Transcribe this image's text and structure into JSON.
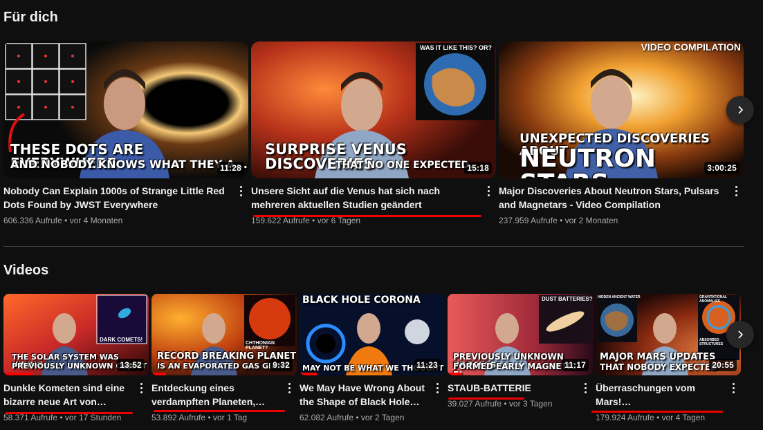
{
  "sections": {
    "for_you": {
      "title": "Für dich",
      "cards": [
        {
          "title": "Nobody Can Explain 1000s of Strange Little Red Dots Found by JWST Everywhere",
          "stats": "606.336 Aufrufe • vor 4 Monaten",
          "duration": "11:28",
          "overlay_line1": "THESE DOTS ARE EVERYWHERE",
          "overlay_line2": "AND NOBODY KNOWS WHAT THEY A..."
        },
        {
          "title": "Unsere Sicht auf die Venus hat sich nach mehreren aktuellen Studien geändert",
          "stats": "159.622 Aufrufe • vor 6 Tagen",
          "duration": "15:18",
          "overlay_line1": "SURPRISE VENUS DISCOVERIES",
          "overlay_line2": "THAT NO ONE EXPECTED...",
          "inset_label": "WAS IT LIKE THIS? OR?"
        },
        {
          "title": "Major Discoveries About Neutron Stars, Pulsars and Magnetars - Video Compilation",
          "stats": "237.959 Aufrufe • vor 2 Monaten",
          "duration": "3:00:25",
          "overlay_line1": "UNEXPECTED DISCOVERIES ABOUT",
          "overlay_line2": "NEUTRON STARS",
          "top_label": "VIDEO COMPILATION"
        }
      ]
    },
    "videos": {
      "title": "Videos",
      "cards": [
        {
          "title": "Dunkle Kometen sind eine bizarre neue Art von Objekt…",
          "stats": "58.371 Aufrufe • vor 17 Stunden",
          "duration": "13:52",
          "overlay_line1": "THE SOLAR SYSTEM WAS HIDING",
          "overlay_line2": "PREVIOUSLY UNKNOWN OBJECT",
          "inset_label": "DARK COMETS!",
          "progress": 0.2
        },
        {
          "title": "Entdeckung eines verdampften Planeten, der…",
          "stats": "53.892 Aufrufe • vor 1 Tag",
          "duration": "9:32",
          "overlay_line1": "RECORD BREAKING PLANET",
          "overlay_line2": "IS AN EVAPORATED GAS GIANT",
          "inset_label": "CHTHONIAN PLANET?",
          "progress": 0.1
        },
        {
          "title": "We May Have Wrong About the Shape of Black Hole…",
          "stats": "62.082 Aufrufe • vor 2 Tagen",
          "duration": "11:23",
          "overlay_line1": "BLACK HOLE CORONA",
          "overlay_line2": "MAY NOT BE WHAT WE THOUGHT",
          "progress": 0.12
        },
        {
          "title": "STAUB-BATTERIE",
          "stats": "39.027 Aufrufe • vor 3 Tagen",
          "duration": "11:17",
          "overlay_line1": "PREVIOUSLY UNKNOWN PROCESS",
          "overlay_line2": "FORMED EARLY MAGNETIC FI...",
          "inset_label": "DUST BATTERIES?",
          "progress": 0.1
        },
        {
          "title": "Überraschungen vom Mars! Gravitationsanomalien,…",
          "stats": "179.924 Aufrufe • vor 4 Tagen",
          "duration": "20:55",
          "overlay_line1": "MAJOR MARS UPDATES",
          "overlay_line2": "THAT NOBODY EXPECTED",
          "inset_label_left": "HIDDEN ANCIENT WATER",
          "inset_label_right": "GRAVITATIONAL ANOMALIES",
          "inset_label_right2": "ABSORBED STRUCTURES"
        }
      ]
    }
  },
  "icons": {
    "next": "chevron-right-icon",
    "menu": "more-vert-icon"
  },
  "colors": {
    "background": "#0f0f0f",
    "text_primary": "#f1f1f1",
    "text_secondary": "#aaaaaa",
    "underline": "#e00000",
    "progress": "#ff0000"
  }
}
